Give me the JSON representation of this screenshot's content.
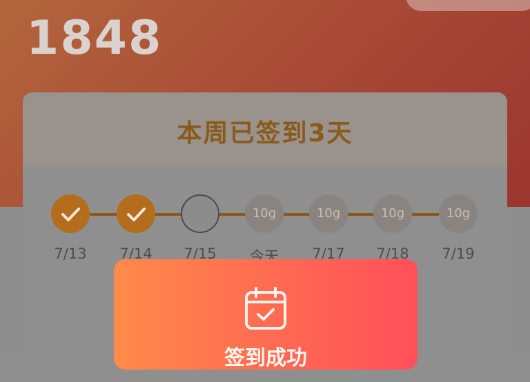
{
  "header": {
    "points": "1848"
  },
  "card": {
    "title": "本周已签到3天"
  },
  "days": [
    {
      "label": "7/13",
      "state": "checked"
    },
    {
      "label": "7/14",
      "state": "checked"
    },
    {
      "label": "7/15",
      "state": "empty"
    },
    {
      "label": "今天",
      "state": "reward",
      "reward": "10g"
    },
    {
      "label": "7/17",
      "state": "reward",
      "reward": "10g"
    },
    {
      "label": "7/18",
      "state": "reward",
      "reward": "10g"
    },
    {
      "label": "7/19",
      "state": "reward",
      "reward": "10g"
    }
  ],
  "modal": {
    "message": "签到成功",
    "icon": "calendar-check-icon"
  },
  "colors": {
    "accent": "#b36d1d",
    "modal_start": "#ff8a4a",
    "modal_end": "#ff4f5a"
  }
}
